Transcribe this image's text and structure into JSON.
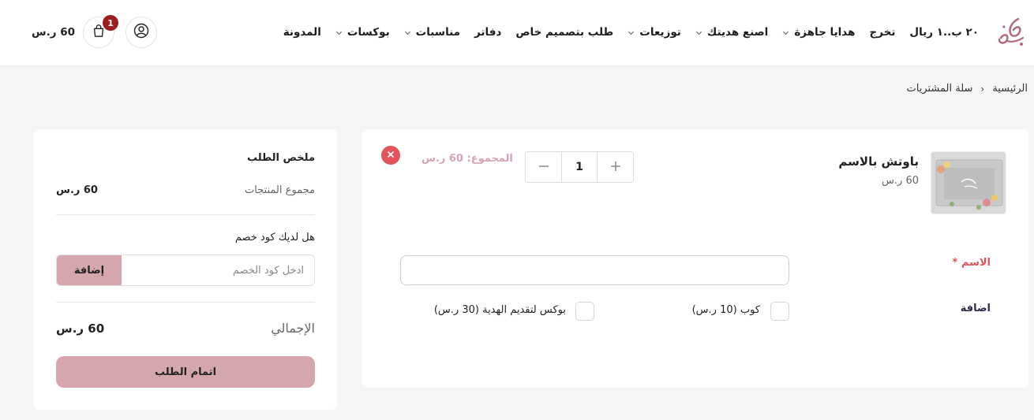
{
  "header": {
    "nav": [
      {
        "label": "٢٠ ب..١ ريال",
        "dropdown": false
      },
      {
        "label": "تخرج",
        "dropdown": false
      },
      {
        "label": "هدايا جاهزة",
        "dropdown": true
      },
      {
        "label": "اصنع هديتك",
        "dropdown": true
      },
      {
        "label": "توزيعات",
        "dropdown": true
      },
      {
        "label": "طلب بتصميم خاص",
        "dropdown": false
      },
      {
        "label": "دفاتر",
        "dropdown": false
      },
      {
        "label": "مناسبات",
        "dropdown": true
      },
      {
        "label": "بوكسات",
        "dropdown": true
      },
      {
        "label": "المدونة",
        "dropdown": false
      }
    ],
    "cart_count": "1",
    "cart_total": "60 ر.س",
    "brand_color": "#9b1d20"
  },
  "breadcrumb": {
    "home": "الرئيسية",
    "current": "سلة المشتريات"
  },
  "cart_item": {
    "name": "باوتش بالاسم",
    "price": "60 ر.س",
    "quantity": "1",
    "line_total": "المجموع: 60 ر.س",
    "name_field_label": "الاسم *",
    "name_field_value": "",
    "addons_label": "اضافة",
    "addons": [
      {
        "label": "كوب (10 ر.س)",
        "checked": false
      },
      {
        "label": "بوكس لتقديم الهدية (30 ر.س)",
        "checked": false
      }
    ]
  },
  "summary": {
    "title": "ملخص الطلب",
    "subtotal_label": "مجموع المنتجات",
    "subtotal_value": "60 ر.س",
    "coupon_question": "هل لديك كود خصم",
    "coupon_placeholder": "ادخل كود الخصم",
    "coupon_button": "إضافة",
    "total_label": "الإجمالي",
    "total_value": "60 ر.س",
    "checkout_button": "اتمام الطلب"
  },
  "colors": {
    "accent": "#d6a6ad",
    "danger": "#e2545b",
    "background": "#f5f5f6"
  }
}
